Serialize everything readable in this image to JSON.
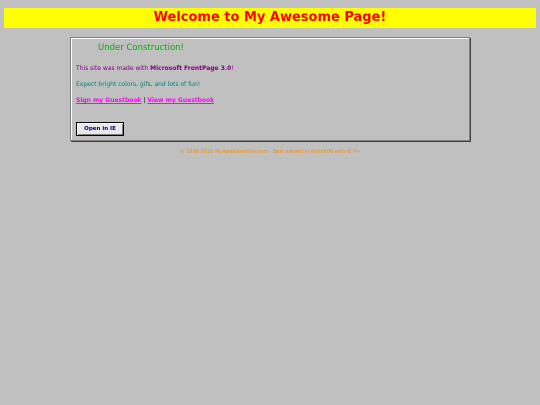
{
  "banner": {
    "title": "Welcome to My Awesome Page!"
  },
  "content": {
    "under_construction": "Under Construction!",
    "made_with_prefix": "This site was made with ",
    "made_with_product": "Microsoft FrontPage 3.0",
    "made_with_suffix": "!",
    "expect_text": "Expect bright colors, gifs, and lots of fun!",
    "sign_guestbook": "Sign my Guestbook",
    "separator": " | ",
    "view_guestbook": "View my Guestbook",
    "open_button": "Open in IE"
  },
  "footer": {
    "text": "© 1998-2025 MyAwesomeSite.com · Best viewed in 800x600 with IE 4+"
  },
  "colors": {
    "background": "#c0c0c0",
    "banner_bg": "#ffff00",
    "banner_text": "#ff0000",
    "under_construction": "#00b000",
    "made_with": "#800080",
    "expect": "#008080",
    "links": "#ff00ff",
    "button_text": "#000080",
    "footer": "#ff8c00"
  }
}
